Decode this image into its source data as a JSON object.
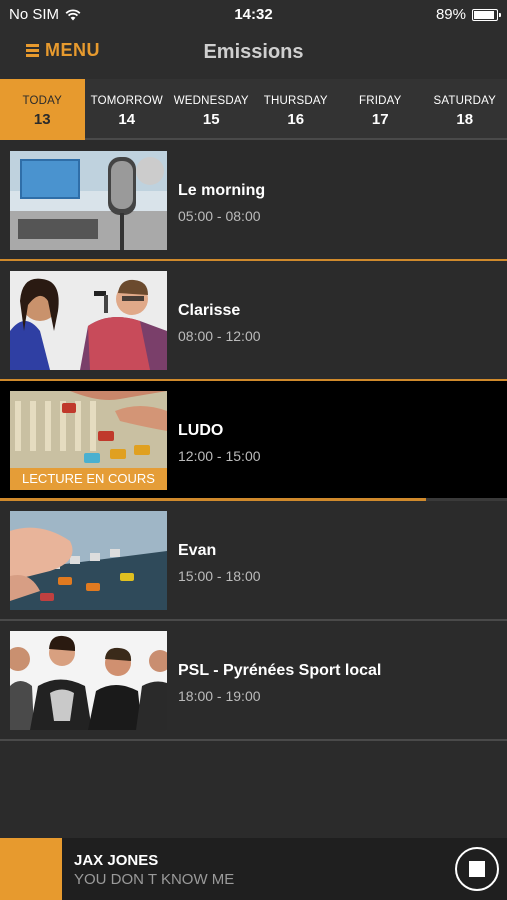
{
  "status": {
    "carrier": "No SIM",
    "time": "14:32",
    "battery": "89%"
  },
  "nav": {
    "menu_label": "MENU",
    "title": "Emissions"
  },
  "days": [
    {
      "name": "TODAY",
      "num": "13",
      "active": true
    },
    {
      "name": "TOMORROW",
      "num": "14"
    },
    {
      "name": "WEDNESDAY",
      "num": "15"
    },
    {
      "name": "THURSDAY",
      "num": "16"
    },
    {
      "name": "FRIDAY",
      "num": "17"
    },
    {
      "name": "SATURDAY",
      "num": "18"
    }
  ],
  "shows": [
    {
      "title": "Le morning",
      "time": "05:00 - 08:00"
    },
    {
      "title": "Clarisse",
      "time": "08:00 - 12:00"
    },
    {
      "title": "LUDO",
      "time": "12:00 - 15:00",
      "now_playing": "LECTURE EN COURS",
      "progress": 0.84
    },
    {
      "title": "Evan",
      "time": "15:00 - 18:00"
    },
    {
      "title": "PSL - Pyrénées Sport local",
      "time": "18:00 - 19:00"
    }
  ],
  "player": {
    "artist": "JAX JONES",
    "track": "YOU DON T KNOW ME"
  },
  "colors": {
    "accent": "#e79a2e"
  }
}
